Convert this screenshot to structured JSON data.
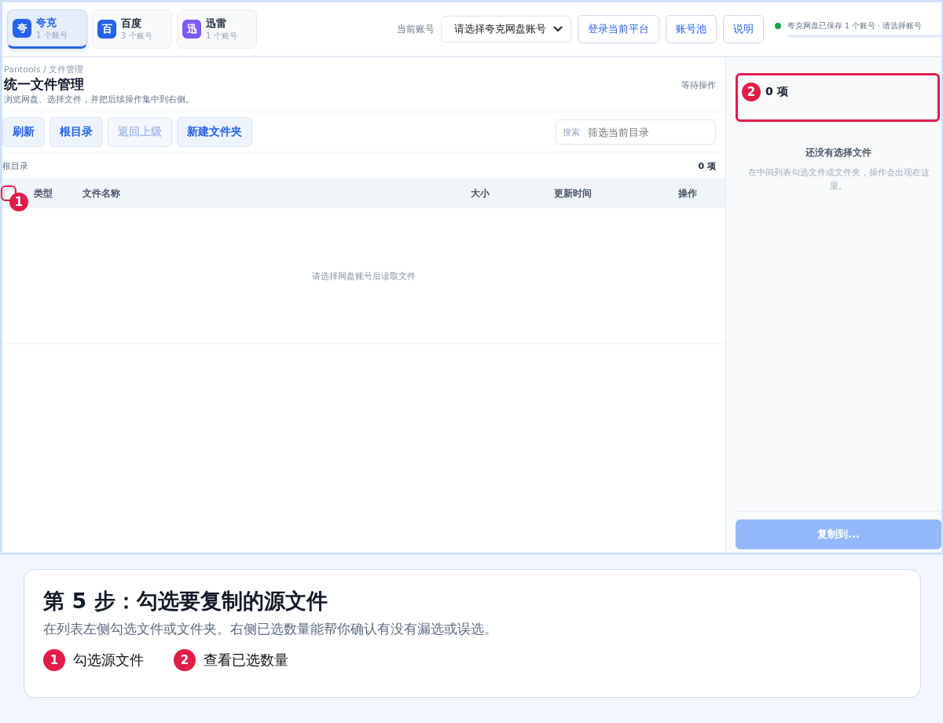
{
  "platforms": [
    {
      "icon": "夸",
      "name": "夸克",
      "count": "1 个账号",
      "color": "#2563eb",
      "selected": true
    },
    {
      "icon": "百",
      "name": "百度",
      "count": "3 个账号",
      "color": "#2563eb",
      "selected": false
    },
    {
      "icon": "迅",
      "name": "迅雷",
      "count": "1 个账号",
      "color": "#7c5cf5",
      "selected": false
    }
  ],
  "account": {
    "label": "当前账号",
    "value": "请选择夸克网盘账号"
  },
  "header_buttons": [
    "登录当前平台",
    "账号池",
    "说明"
  ],
  "status": {
    "text": "夸克网盘已保存 1 个账号 · 请选择账号",
    "color": "#16a34a"
  },
  "page": {
    "breadcrumb": "Pantools / 文件管理",
    "title": "统一文件管理",
    "subtitle": "浏览网盘、选择文件，并把后续操作集中到右侧。",
    "state": "等待操作"
  },
  "toolbar": [
    {
      "label": "刷新",
      "disabled": false
    },
    {
      "label": "根目录",
      "disabled": false
    },
    {
      "label": "返回上级",
      "disabled": true
    },
    {
      "label": "新建文件夹",
      "disabled": false
    }
  ],
  "search": {
    "label": "搜索",
    "placeholder": "筛选当前目录"
  },
  "path": {
    "text": "根目录",
    "count": "0 项"
  },
  "table": {
    "columns": [
      "类型",
      "文件名称",
      "大小",
      "更新时间",
      "操作"
    ],
    "select_all": {
      "checked": false
    },
    "empty": "请选择网盘账号后读取文件"
  },
  "selection": {
    "count": "0 项",
    "empty_title": "还没有选择文件",
    "empty_note": "在中间列表勾选文件或文件夹，操作会出现在这里。",
    "action": {
      "label": "复制到...",
      "disabled": true
    }
  },
  "callouts": [
    {
      "number": "1",
      "color": "#e11d48"
    },
    {
      "number": "2",
      "color": "#e11d48"
    }
  ],
  "caption": {
    "title": "第 5 步：勾选要复制的源文件",
    "description": "在列表左侧勾选文件或文件夹。右侧已选数量能帮你确认有没有漏选或误选。",
    "legend": [
      {
        "number": "1",
        "text": "勾选源文件"
      },
      {
        "number": "2",
        "text": "查看已选数量"
      }
    ]
  }
}
